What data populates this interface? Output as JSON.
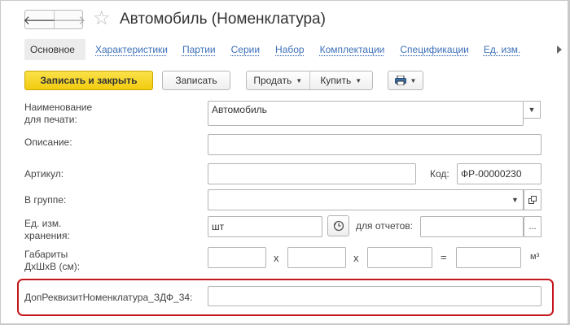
{
  "header": {
    "title": "Автомобиль (Номенклатура)",
    "back_glyph": "🡐",
    "forward_glyph": "🡒",
    "star_glyph": "☆"
  },
  "tabs": [
    {
      "label": "Основное",
      "active": true
    },
    {
      "label": "Характеристики"
    },
    {
      "label": "Партии"
    },
    {
      "label": "Серии"
    },
    {
      "label": "Набор"
    },
    {
      "label": "Комплектации"
    },
    {
      "label": "Спецификации"
    },
    {
      "label": "Ед. изм."
    }
  ],
  "toolbar": {
    "save_close_label": "Записать и закрыть",
    "save_label": "Записать",
    "sell_label": "Продать",
    "buy_label": "Купить",
    "print_icon": "printer-icon"
  },
  "form": {
    "print_name_label": "Наименование\nдля печати:",
    "print_name_value": "Автомобиль",
    "description_label": "Описание:",
    "description_value": "",
    "article_label": "Артикул:",
    "article_value": "",
    "code_label": "Код:",
    "code_value": "ФР-00000230",
    "group_label": "В группе:",
    "group_value": "",
    "unit_label": "Ед. изм.\nхранения:",
    "unit_value": "шт",
    "reports_label": "для отчетов:",
    "reports_value": "",
    "dims_label": "Габариты\nДхШхВ (см):",
    "dims_x": "x",
    "dims_eq": "=",
    "dims_unit": "м³",
    "extra_label": "ДопРеквизитНоменклатура_ЗДФ_34:",
    "extra_value": ""
  },
  "colors": {
    "primary_button": "#f5d21a",
    "link": "#3c6fb8",
    "highlight": "#c4161c"
  }
}
